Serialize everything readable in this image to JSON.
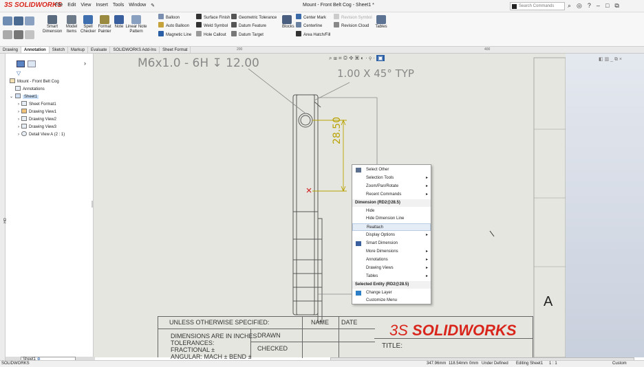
{
  "app": {
    "logo_prefix": "3S",
    "logo_text": "SOLIDWORKS",
    "doc_title": "Mount - Front Belt Cog - Sheet1 *"
  },
  "menu": [
    "File",
    "Edit",
    "View",
    "Insert",
    "Tools",
    "Window"
  ],
  "search": {
    "placeholder": "Search Commands"
  },
  "ribbon": {
    "big_buttons": [
      "Smart Dimension",
      "Model Items",
      "Spell Checker",
      "Format Painter",
      "Note",
      "Linear Note Pattern",
      "Blocks",
      "Tables"
    ],
    "small_items": [
      "Balloon",
      "Auto Balloon",
      "Magnetic Line",
      "Surface Finish",
      "Weld Symbol",
      "Hole Callout",
      "Geometric Tolerance",
      "Datum Feature",
      "Datum Target",
      "Center Mark",
      "Centerline",
      "Area Hatch/Fill",
      "Revision Symbol",
      "Revision Cloud"
    ]
  },
  "tabs": [
    "Drawing",
    "Annotation",
    "Sketch",
    "Markup",
    "Evaluate",
    "SOLIDWORKS Add-Ins",
    "Sheet Format"
  ],
  "ruler": {
    "t1": "200",
    "t2": "400"
  },
  "tree": {
    "root": "Mount - Front Belt Cog",
    "items": [
      "Annotations",
      "Sheet1",
      "Sheet Format1",
      "Drawing View1",
      "Drawing View2",
      "Drawing View3",
      "Detail View A (2 : 1)"
    ]
  },
  "drawing": {
    "thread_callout": "M6x1.0 - 6H ↧ 12.00",
    "chamfer_callout": "1.00 X 45° TYP",
    "dimension": "28.50",
    "view_label": "A",
    "side_label": "HO"
  },
  "title_block": {
    "unless": "UNLESS OTHERWISE SPECIFIED:",
    "name": "NAME",
    "date": "DATE",
    "dims": "DIMENSIONS ARE IN INCHES",
    "tolerances": "TOLERANCES:",
    "fractional": "FRACTIONAL ±",
    "angular": "ANGULAR: MACH ±    BEND ±",
    "drawn": "DRAWN",
    "checked": "CHECKED",
    "title": "TITLE:",
    "logo_prefix": "3S",
    "logo_text": "SOLIDWORKS"
  },
  "context_menu": [
    {
      "label": "Select Other",
      "type": "item",
      "icon": "select-other-icon"
    },
    {
      "label": "Selection Tools",
      "type": "submenu"
    },
    {
      "label": "Zoom/Pan/Rotate",
      "type": "submenu"
    },
    {
      "label": "Recent Commands",
      "type": "submenu"
    },
    {
      "label": "Dimension (RD2@28.5)",
      "type": "header"
    },
    {
      "label": "Hide",
      "type": "item"
    },
    {
      "label": "Hide Dimension Line",
      "type": "item"
    },
    {
      "label": "Reattach",
      "type": "item",
      "highlight": true
    },
    {
      "label": "Display Options",
      "type": "submenu"
    },
    {
      "label": "Smart Dimension",
      "type": "item",
      "icon": "smart-dimension-icon"
    },
    {
      "label": "More Dimensions",
      "type": "submenu"
    },
    {
      "label": "Annotations",
      "type": "submenu"
    },
    {
      "label": "Drawing Views",
      "type": "submenu"
    },
    {
      "label": "Tables",
      "type": "submenu"
    },
    {
      "label": "Selected Entity (RD2@28.5)",
      "type": "header"
    },
    {
      "label": "Change Layer",
      "type": "item",
      "icon": "change-layer-icon"
    },
    {
      "label": "Customize Menu",
      "type": "item"
    }
  ],
  "sheet_tab": "Sheet1",
  "status": {
    "app": "SOLIDWORKS",
    "x": "347.96mm",
    "y": "118.54mm",
    "z": "0mm",
    "state": "Under Defined",
    "editing": "Editing Sheet1",
    "scale": "1 : 1",
    "units": "Custom"
  },
  "colors": {
    "brand": "#d9261c",
    "dim": "#b8a200",
    "menu_highlight": "#e4ecf6"
  }
}
